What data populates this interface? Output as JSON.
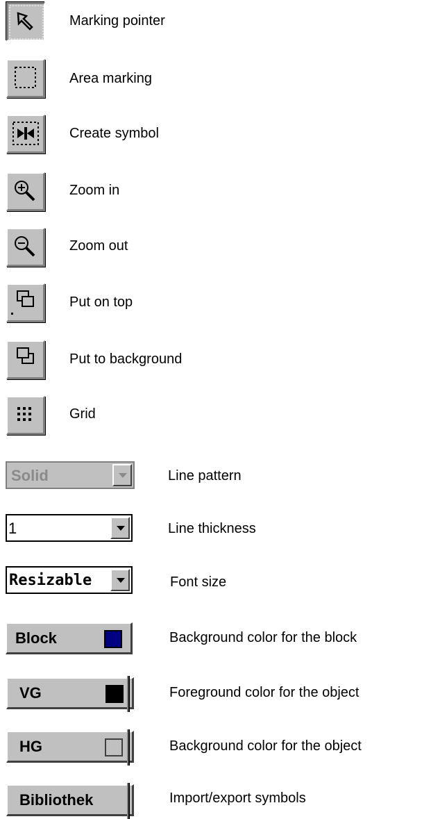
{
  "tools": [
    {
      "icon": "marking-pointer-icon",
      "label": "Marking pointer"
    },
    {
      "icon": "area-marking-icon",
      "label": "Area marking"
    },
    {
      "icon": "create-symbol-icon",
      "label": "Create symbol"
    },
    {
      "icon": "zoom-in-icon",
      "label": "Zoom in"
    },
    {
      "icon": "zoom-out-icon",
      "label": "Zoom out"
    },
    {
      "icon": "put-on-top-icon",
      "label": "Put on top"
    },
    {
      "icon": "put-to-background-icon",
      "label": "Put to background"
    },
    {
      "icon": "grid-icon",
      "label": "Grid"
    }
  ],
  "line_pattern": {
    "value": "Solid",
    "label": "Line pattern",
    "disabled": true
  },
  "line_thickness": {
    "value": "1",
    "label": "Line thickness"
  },
  "font_size": {
    "value": "Resizable",
    "label": "Font size"
  },
  "block_color": {
    "button": "Block",
    "label": "Background color for the block",
    "swatch_color": "#000080"
  },
  "fg_color": {
    "button": "VG",
    "label": "Foreground color for the object",
    "swatch_color": "#000000"
  },
  "bg_color": {
    "button": "HG",
    "label": "Background color for the object",
    "swatch_color": "#c0c0c0"
  },
  "library": {
    "button": "Bibliothek",
    "label": "Import/export symbols"
  }
}
